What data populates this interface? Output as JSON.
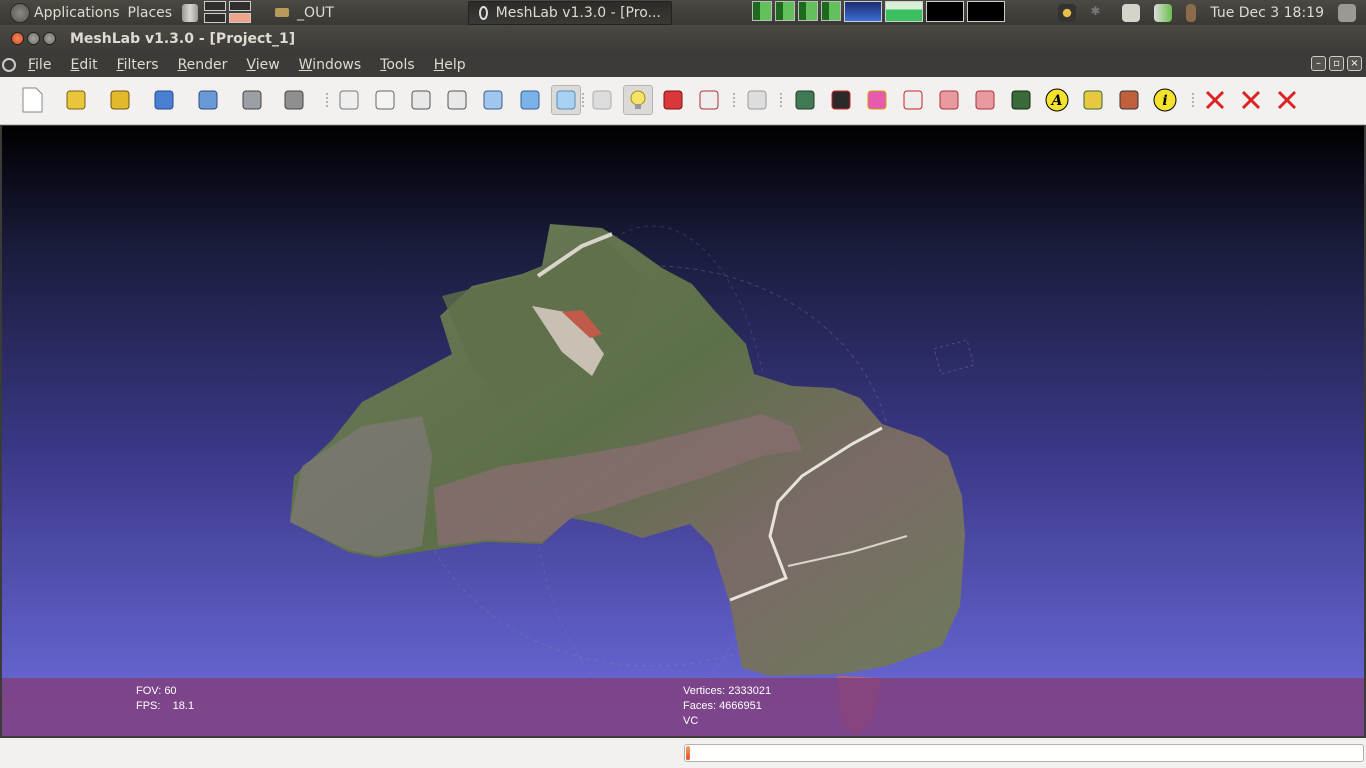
{
  "top_panel": {
    "applications_label": "Applications",
    "places_label": "Places",
    "out_task_label": "_OUT",
    "meshlab_task_label": "MeshLab v1.3.0 - [Pro...",
    "clock": "Tue Dec  3  18:19"
  },
  "window": {
    "title": "MeshLab v1.3.0 - [Project_1]"
  },
  "menubar": {
    "items": [
      "File",
      "Edit",
      "Filters",
      "Render",
      "View",
      "Windows",
      "Tools",
      "Help"
    ]
  },
  "toolbar": {
    "icons": [
      "new-document-icon",
      "open-icon",
      "open-project-icon",
      "reload-icon",
      "save-icon",
      "snapshot-icon",
      "layers-icon",
      "bounding-box-icon",
      "points-icon",
      "wireframe-icon",
      "hidden-lines-icon",
      "flat-lines-icon",
      "flat-icon",
      "smooth-icon",
      "texture-icon",
      "light-icon",
      "double-side-lighting-icon",
      "quality-icon",
      "select-info-icon",
      "measure-icon",
      "pick-points-icon",
      "paint-icon",
      "select-faces-icon",
      "select-vertices-icon",
      "select-connected-icon",
      "align-icon",
      "annotation-icon",
      "brush-icon",
      "z-paint-icon",
      "info-icon",
      "delete-faces-icon",
      "delete-vertices-icon",
      "delete-all-icon"
    ],
    "pressed": [
      "smooth-icon",
      "light-icon"
    ]
  },
  "viewport": {
    "info_left": [
      "FOV: 60",
      "FPS:    18.1"
    ],
    "info_right": [
      "Vertices: 2333021",
      "Faces: 4666951",
      "VC"
    ],
    "background_top": "#000000",
    "background_bottom": "#6f6ee0",
    "info_bar_color": "#804080"
  },
  "status": {
    "progress": 0.005
  }
}
